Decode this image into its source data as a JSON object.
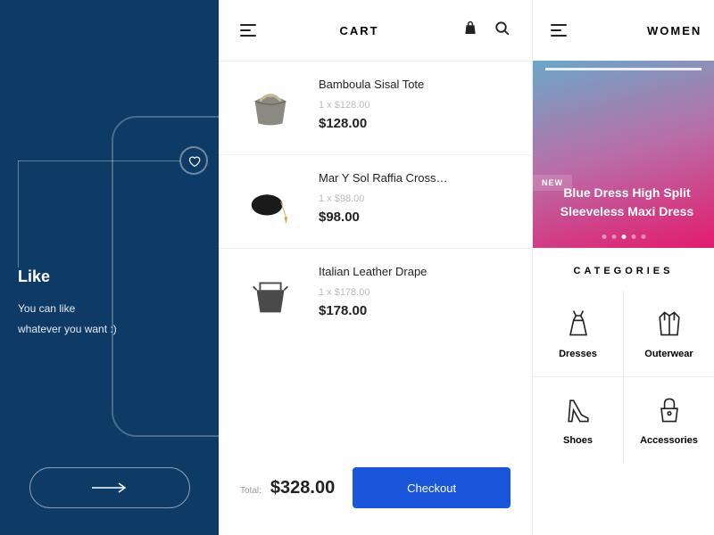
{
  "onboarding": {
    "title": "Like",
    "line1": "You can like",
    "line2": "whatever you want :)"
  },
  "cart": {
    "title": "CART",
    "items": [
      {
        "name": "Bamboula Sisal Tote",
        "qty": "1 x $128.00",
        "price": "$128.00"
      },
      {
        "name": "Mar Y Sol Raffia Cross…",
        "qty": "1 x $98.00",
        "price": "$98.00"
      },
      {
        "name": "Italian Leather Drape",
        "qty": "1 x $178.00",
        "price": "$178.00"
      }
    ],
    "total_label": "Total:",
    "total": "$328.00",
    "checkout_label": "Checkout"
  },
  "shop": {
    "title": "WOMEN",
    "hero_badge": "NEW",
    "hero_title": "Blue Dress High Split Sleeveless Maxi Dress",
    "categories_title": "CATEGORIES",
    "categories": [
      {
        "label": "Dresses"
      },
      {
        "label": "Outerwear"
      },
      {
        "label": "Shoes"
      },
      {
        "label": "Accessories"
      }
    ]
  }
}
